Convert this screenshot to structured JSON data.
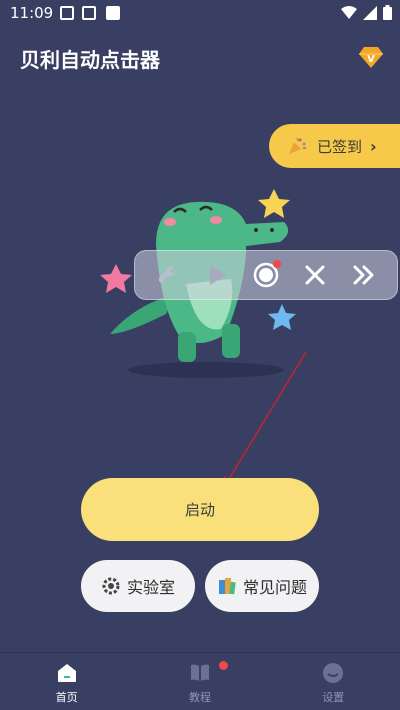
{
  "status": {
    "time": "11:09"
  },
  "header": {
    "title": "贝利自动点击器",
    "vip_icon": "diamond-v-icon"
  },
  "checkin": {
    "label": "已签到",
    "icon": "party-popper-icon"
  },
  "float_toolbar": {
    "buttons": [
      "wrench-icon",
      "play-icon",
      "record-icon",
      "close-icon",
      "fast-forward-icon"
    ]
  },
  "main": {
    "start_label": "启动",
    "lab_label": "实验室",
    "faq_label": "常见问题"
  },
  "nav": {
    "items": [
      {
        "label": "首页",
        "active": true
      },
      {
        "label": "教程",
        "active": false
      },
      {
        "label": "设置",
        "active": false
      }
    ]
  },
  "colors": {
    "background": "#383f63",
    "accent": "#f7c94a",
    "start_button": "#f9e07a"
  }
}
